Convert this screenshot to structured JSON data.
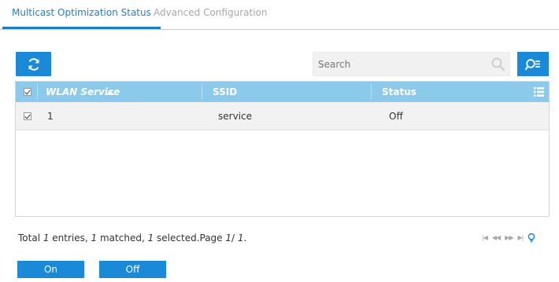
{
  "tabs": [
    {
      "label": "Multicast Optimization Status"
    },
    {
      "label": "Advanced Configuration"
    }
  ],
  "toolbar": {
    "refresh_icon": "refresh-icon",
    "search_placeholder": "Search",
    "search_icon": "search-icon",
    "advanced_search_icon": "advanced-search-icon"
  },
  "table": {
    "columns": [
      {
        "label": "WLAN Service",
        "sorted": "ascending"
      },
      {
        "label": "SSID"
      },
      {
        "label": "Status"
      }
    ],
    "rows": [
      {
        "selected": true,
        "wlan_service": "1",
        "ssid": "service",
        "status": "Off"
      }
    ]
  },
  "footer": {
    "prefix": "Total ",
    "total": "1",
    "entries_text": " entries, ",
    "matched": "1",
    "matched_text": " matched, ",
    "selected": "1",
    "selected_text": " selected.Page ",
    "page": "1",
    "slash": "/ ",
    "pages": "1",
    "end": "."
  },
  "pager": {
    "first": "|◀",
    "prev": "◀◀",
    "next": "▶▶",
    "last": "▶|"
  },
  "actions": {
    "on_label": "On",
    "off_label": "Off"
  },
  "colors": {
    "accent": "#1a8ad8",
    "header_bg": "#8bcaeb",
    "active_tab": "#1f7fc4"
  }
}
